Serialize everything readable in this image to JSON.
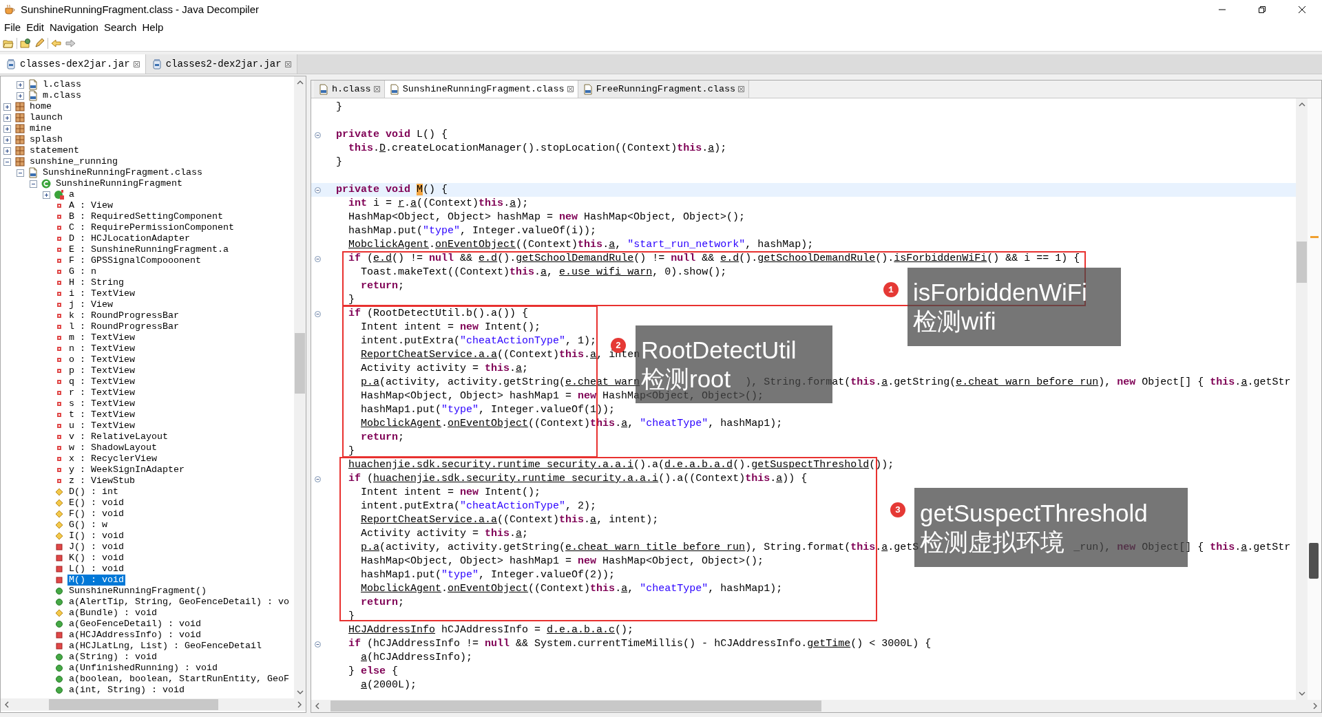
{
  "window": {
    "title": "SunshineRunningFragment.class - Java Decompiler"
  },
  "menu": [
    "File",
    "Edit",
    "Navigation",
    "Search",
    "Help"
  ],
  "jar_tabs": [
    {
      "label": "classes-dex2jar.jar",
      "selected": true
    },
    {
      "label": "classes2-dex2jar.jar",
      "selected": false
    }
  ],
  "tree": {
    "partial_branch": [
      {
        "label": "l.class",
        "kind": "class-file",
        "expanded": false,
        "selected": false
      },
      {
        "label": "m.class",
        "kind": "class-file",
        "expanded": false,
        "selected": false
      }
    ],
    "items": [
      {
        "label": "home",
        "kind": "package",
        "expanded": false,
        "selected": false
      },
      {
        "label": "launch",
        "kind": "package",
        "expanded": false,
        "selected": false
      },
      {
        "label": "mine",
        "kind": "package",
        "expanded": false,
        "selected": false
      },
      {
        "label": "splash",
        "kind": "package",
        "expanded": false,
        "selected": false
      },
      {
        "label": "statement",
        "kind": "package",
        "expanded": false,
        "selected": false
      },
      {
        "label": "sunshine_running",
        "kind": "package",
        "expanded": true,
        "selected": false,
        "children": [
          {
            "label": "SunshineRunningFragment.class",
            "kind": "class-file",
            "expanded": true,
            "selected": false,
            "children": [
              {
                "label": "SunshineRunningFragment",
                "kind": "class",
                "expanded": true,
                "selected": false,
                "children": [
                  {
                    "label": "a",
                    "kind": "inner-class",
                    "expanded": false,
                    "selected": false
                  },
                  {
                    "label": "A : View",
                    "kind": "field",
                    "selected": false
                  },
                  {
                    "label": "B : RequiredSettingComponent",
                    "kind": "field",
                    "selected": false
                  },
                  {
                    "label": "C : RequirePermissionComponent",
                    "kind": "field",
                    "selected": false
                  },
                  {
                    "label": "D : HCJLocationAdapter",
                    "kind": "field",
                    "selected": false
                  },
                  {
                    "label": "E : SunshineRunningFragment.a",
                    "kind": "field",
                    "selected": false
                  },
                  {
                    "label": "F : GPSSignalCompooonent",
                    "kind": "field",
                    "selected": false
                  },
                  {
                    "label": "G : n",
                    "kind": "field",
                    "selected": false
                  },
                  {
                    "label": "H : String",
                    "kind": "field",
                    "selected": false
                  },
                  {
                    "label": "i : TextView",
                    "kind": "field",
                    "selected": false
                  },
                  {
                    "label": "j : View",
                    "kind": "field",
                    "selected": false
                  },
                  {
                    "label": "k : RoundProgressBar",
                    "kind": "field",
                    "selected": false
                  },
                  {
                    "label": "l : RoundProgressBar",
                    "kind": "field",
                    "selected": false
                  },
                  {
                    "label": "m : TextView",
                    "kind": "field",
                    "selected": false
                  },
                  {
                    "label": "n : TextView",
                    "kind": "field",
                    "selected": false
                  },
                  {
                    "label": "o : TextView",
                    "kind": "field",
                    "selected": false
                  },
                  {
                    "label": "p : TextView",
                    "kind": "field",
                    "selected": false
                  },
                  {
                    "label": "q : TextView",
                    "kind": "field",
                    "selected": false
                  },
                  {
                    "label": "r : TextView",
                    "kind": "field",
                    "selected": false
                  },
                  {
                    "label": "s : TextView",
                    "kind": "field",
                    "selected": false
                  },
                  {
                    "label": "t : TextView",
                    "kind": "field",
                    "selected": false
                  },
                  {
                    "label": "u : TextView",
                    "kind": "field",
                    "selected": false
                  },
                  {
                    "label": "v : RelativeLayout",
                    "kind": "field",
                    "selected": false
                  },
                  {
                    "label": "w : ShadowLayout",
                    "kind": "field",
                    "selected": false
                  },
                  {
                    "label": "x : RecyclerView",
                    "kind": "field",
                    "selected": false
                  },
                  {
                    "label": "y : WeekSignInAdapter",
                    "kind": "field",
                    "selected": false
                  },
                  {
                    "label": "z : ViewStub",
                    "kind": "field",
                    "selected": false
                  },
                  {
                    "label": "D() : int",
                    "kind": "default-method",
                    "selected": false
                  },
                  {
                    "label": "E() : void",
                    "kind": "default-method",
                    "selected": false
                  },
                  {
                    "label": "F() : void",
                    "kind": "default-method",
                    "selected": false
                  },
                  {
                    "label": "G() : w",
                    "kind": "default-method",
                    "selected": false
                  },
                  {
                    "label": "I() : void",
                    "kind": "default-method",
                    "selected": false
                  },
                  {
                    "label": "J() : void",
                    "kind": "private-method",
                    "selected": false
                  },
                  {
                    "label": "K() : void",
                    "kind": "private-method",
                    "selected": false
                  },
                  {
                    "label": "L() : void",
                    "kind": "private-method",
                    "selected": false
                  },
                  {
                    "label": "M() : void",
                    "kind": "private-method",
                    "selected": true
                  },
                  {
                    "label": "SunshineRunningFragment()",
                    "kind": "public-method",
                    "selected": false
                  },
                  {
                    "label": "a(AlertTip, String, GeoFenceDetail) : vo",
                    "kind": "public-method",
                    "selected": false
                  },
                  {
                    "label": "a(Bundle) : void",
                    "kind": "default-method",
                    "selected": false
                  },
                  {
                    "label": "a(GeoFenceDetail) : void",
                    "kind": "public-method",
                    "selected": false
                  },
                  {
                    "label": "a(HCJAddressInfo) : void",
                    "kind": "private-method",
                    "selected": false
                  },
                  {
                    "label": "a(HCJLatLng, List) : GeoFenceDetail",
                    "kind": "private-method",
                    "selected": false
                  },
                  {
                    "label": "a(String) : void",
                    "kind": "public-method",
                    "selected": false
                  },
                  {
                    "label": "a(UnfinishedRunning) : void",
                    "kind": "public-method",
                    "selected": false
                  },
                  {
                    "label": "a(boolean, boolean, StartRunEntity, GeoF",
                    "kind": "public-method",
                    "selected": false
                  },
                  {
                    "label": "a(int, String) : void",
                    "kind": "public-method",
                    "selected": false
                  }
                ]
              }
            ]
          }
        ]
      }
    ]
  },
  "editor_tabs": [
    {
      "label": "h.class",
      "selected": false
    },
    {
      "label": "SunshineRunningFragment.class",
      "selected": true
    },
    {
      "label": "FreeRunningFragment.class",
      "selected": false
    }
  ],
  "editor": {
    "lines": [
      {
        "fold": false,
        "selected": false,
        "tokens": [
          "  }"
        ]
      },
      {
        "fold": false,
        "selected": false
      },
      {
        "fold": true,
        "selected": false,
        "tokens": [
          {
            "kind": "keyword",
            "text": "  private "
          },
          {
            "kind": "keyword",
            "text": "void"
          },
          " L() {"
        ]
      },
      {
        "fold": false,
        "selected": false,
        "tokens": [
          {
            "kind": "keyword",
            "text": "    this"
          },
          ".",
          {
            "kind": "link",
            "text": "D"
          },
          ".createLocationManager().stopLocation((Context)",
          {
            "kind": "keyword",
            "text": "this"
          },
          ".",
          {
            "kind": "link",
            "text": "a"
          },
          ");"
        ]
      },
      {
        "fold": false,
        "selected": false,
        "tokens": [
          "  }"
        ]
      },
      {
        "fold": false,
        "selected": false
      },
      {
        "fold": true,
        "selected": true,
        "tokens": [
          {
            "kind": "keyword",
            "text": "  private "
          },
          {
            "kind": "keyword",
            "text": "void "
          },
          {
            "kind": "match",
            "text": "M"
          },
          "() {"
        ]
      },
      {
        "fold": false,
        "selected": false,
        "tokens": [
          {
            "kind": "keyword",
            "text": "    int"
          },
          " i = ",
          {
            "kind": "link",
            "text": "r"
          },
          ".",
          {
            "kind": "link",
            "text": "a"
          },
          "((Context)",
          {
            "kind": "keyword",
            "text": "this"
          },
          ".",
          {
            "kind": "link",
            "text": "a"
          },
          ");"
        ]
      },
      {
        "fold": false,
        "selected": false,
        "tokens": [
          "    HashMap<Object, Object> hashMap = ",
          {
            "kind": "keyword",
            "text": "new"
          },
          " HashMap<Object, Object>();"
        ]
      },
      {
        "fold": false,
        "selected": false,
        "tokens": [
          "    hashMap.put(",
          {
            "kind": "string",
            "text": "\"type\""
          },
          ", Integer.valueOf(i));"
        ]
      },
      {
        "fold": false,
        "selected": false,
        "tokens": [
          {
            "kind": "link",
            "text": "    MobclickAgent"
          },
          ".",
          {
            "kind": "link",
            "text": "onEventObject"
          },
          "((Context)",
          {
            "kind": "keyword",
            "text": "this"
          },
          ".",
          {
            "kind": "link",
            "text": "a"
          },
          ", ",
          {
            "kind": "string",
            "text": "\"start_run_network\""
          },
          ", hashMap);"
        ]
      },
      {
        "fold": true,
        "selected": false,
        "tokens": [
          {
            "kind": "keyword",
            "text": "    if"
          },
          " (",
          {
            "kind": "link",
            "text": "e.d"
          },
          "() != ",
          {
            "kind": "keyword",
            "text": "null"
          },
          " && ",
          {
            "kind": "link",
            "text": "e.d"
          },
          "().",
          {
            "kind": "link",
            "text": "getSchoolDemandRule"
          },
          "() != ",
          {
            "kind": "keyword",
            "text": "null"
          },
          " && ",
          {
            "kind": "link",
            "text": "e.d"
          },
          "().",
          {
            "kind": "link",
            "text": "getSchoolDemandRule"
          },
          "().",
          {
            "kind": "link",
            "text": "isForbiddenWiFi"
          },
          "() && i == 1) {"
        ]
      },
      {
        "fold": false,
        "selected": false,
        "tokens": [
          "      Toast.makeText((Context)",
          {
            "kind": "keyword",
            "text": "this"
          },
          ".",
          {
            "kind": "link",
            "text": "a"
          },
          ", ",
          {
            "kind": "link",
            "text": "e.use_wifi_warn"
          },
          ", 0).show();"
        ]
      },
      {
        "fold": false,
        "selected": false,
        "tokens": [
          {
            "kind": "keyword",
            "text": "      return"
          },
          ";"
        ]
      },
      {
        "fold": false,
        "selected": false,
        "tokens": [
          "    }"
        ]
      },
      {
        "fold": true,
        "selected": false,
        "tokens": [
          {
            "kind": "keyword",
            "text": "    if"
          },
          " (RootDetectUtil.b().a()) {"
        ]
      },
      {
        "fold": false,
        "selected": false,
        "tokens": [
          "      Intent intent = ",
          {
            "kind": "keyword",
            "text": "new"
          },
          " Intent();"
        ]
      },
      {
        "fold": false,
        "selected": false,
        "tokens": [
          "      intent.putExtra(",
          {
            "kind": "string",
            "text": "\"cheatActionType\""
          },
          ", 1);"
        ]
      },
      {
        "fold": false,
        "selected": false,
        "tokens": [
          {
            "kind": "link",
            "text": "      ReportCheatService.a.a"
          },
          "((Context)",
          {
            "kind": "keyword",
            "text": "this"
          },
          ".",
          {
            "kind": "link",
            "text": "a"
          },
          ", inten"
        ]
      },
      {
        "fold": false,
        "selected": false,
        "tokens": [
          "      Activity activity = ",
          {
            "kind": "keyword",
            "text": "this"
          },
          ".",
          {
            "kind": "link",
            "text": "a"
          },
          ";"
        ]
      },
      {
        "fold": false,
        "selected": false,
        "tokens": [
          {
            "kind": "link",
            "text": "      p.a"
          },
          "(activity, activity.getString(",
          {
            "kind": "link",
            "text": "e.cheat_warn"
          }
        ],
        "resume": [
          "), String.format(",
          {
            "kind": "keyword",
            "text": "this"
          },
          ".",
          {
            "kind": "link",
            "text": "a"
          },
          ".getString(",
          {
            "kind": "link",
            "text": "e.cheat_warn_before_run"
          },
          "), ",
          {
            "kind": "keyword",
            "text": "new"
          },
          " Object[] { ",
          {
            "kind": "keyword",
            "text": "this"
          },
          ".",
          {
            "kind": "link",
            "text": "a"
          },
          ".getStr"
        ]
      },
      {
        "fold": false,
        "selected": false,
        "tokens": [
          "      HashMap<Object, Object> hashMap1 = ",
          {
            "kind": "keyword",
            "text": "new"
          },
          " HashMap<Object, Object>();"
        ]
      },
      {
        "fold": false,
        "selected": false,
        "tokens": [
          "      hashMap1.put(",
          {
            "kind": "string",
            "text": "\"type\""
          },
          ", Integer.valueOf(1));"
        ]
      },
      {
        "fold": false,
        "selected": false,
        "tokens": [
          {
            "kind": "link",
            "text": "      MobclickAgent"
          },
          ".",
          {
            "kind": "link",
            "text": "onEventObject"
          },
          "((Context)",
          {
            "kind": "keyword",
            "text": "this"
          },
          ".",
          {
            "kind": "link",
            "text": "a"
          },
          ", ",
          {
            "kind": "string",
            "text": "\"cheatType\""
          },
          ", hashMap1);"
        ]
      },
      {
        "fold": false,
        "selected": false,
        "tokens": [
          {
            "kind": "keyword",
            "text": "      return"
          },
          ";"
        ]
      },
      {
        "fold": false,
        "selected": false,
        "tokens": [
          "    }"
        ]
      },
      {
        "fold": false,
        "selected": false,
        "tokens": [
          {
            "kind": "link",
            "text": "    huachenjie.sdk.security.runtime_security.a.a.i"
          },
          "().a(",
          {
            "kind": "link",
            "text": "d.e.a.b.a.d"
          },
          "().",
          {
            "kind": "link",
            "text": "getSuspectThreshold"
          },
          "());"
        ]
      },
      {
        "fold": true,
        "selected": false,
        "tokens": [
          {
            "kind": "keyword",
            "text": "    if"
          },
          " (",
          {
            "kind": "link",
            "text": "huachenjie.sdk.security.runtime_security.a.a.i"
          },
          "().a((Context)",
          {
            "kind": "keyword",
            "text": "this"
          },
          ".",
          {
            "kind": "link",
            "text": "a"
          },
          ")) {"
        ]
      },
      {
        "fold": false,
        "selected": false,
        "tokens": [
          "      Intent intent = ",
          {
            "kind": "keyword",
            "text": "new"
          },
          " Intent();"
        ]
      },
      {
        "fold": false,
        "selected": false,
        "tokens": [
          "      intent.putExtra(",
          {
            "kind": "string",
            "text": "\"cheatActionType\""
          },
          ", 2);"
        ]
      },
      {
        "fold": false,
        "selected": false,
        "tokens": [
          {
            "kind": "link",
            "text": "      ReportCheatService.a.a"
          },
          "((Context)",
          {
            "kind": "keyword",
            "text": "this"
          },
          ".",
          {
            "kind": "link",
            "text": "a"
          },
          ", intent);"
        ]
      },
      {
        "fold": false,
        "selected": false,
        "tokens": [
          "      Activity activity = ",
          {
            "kind": "keyword",
            "text": "this"
          },
          ".",
          {
            "kind": "link",
            "text": "a"
          },
          ";"
        ]
      },
      {
        "fold": false,
        "selected": false,
        "tokens": [
          {
            "kind": "link",
            "text": "      p.a"
          },
          "(activity, activity.getString(",
          {
            "kind": "link",
            "text": "e.cheat_warn_title_before_run"
          },
          "), String.format(",
          {
            "kind": "keyword",
            "text": "this"
          },
          ".",
          {
            "kind": "link",
            "text": "a"
          },
          ".getS"
        ],
        "resume": [
          "_run), ",
          {
            "kind": "keyword",
            "text": "new"
          },
          " Object[] { ",
          {
            "kind": "keyword",
            "text": "this"
          },
          ".",
          {
            "kind": "link",
            "text": "a"
          },
          ".getStr"
        ]
      },
      {
        "fold": false,
        "selected": false,
        "tokens": [
          "      HashMap<Object, Object> hashMap1 = ",
          {
            "kind": "keyword",
            "text": "new"
          },
          " HashMap<Object, Object>();"
        ]
      },
      {
        "fold": false,
        "selected": false,
        "tokens": [
          "      hashMap1.put(",
          {
            "kind": "string",
            "text": "\"type\""
          },
          ", Integer.valueOf(2));"
        ]
      },
      {
        "fold": false,
        "selected": false,
        "tokens": [
          {
            "kind": "link",
            "text": "      MobclickAgent"
          },
          ".",
          {
            "kind": "link",
            "text": "onEventObject"
          },
          "((Context)",
          {
            "kind": "keyword",
            "text": "this"
          },
          ".",
          {
            "kind": "link",
            "text": "a"
          },
          ", ",
          {
            "kind": "string",
            "text": "\"cheatType\""
          },
          ", hashMap1);"
        ]
      },
      {
        "fold": false,
        "selected": false,
        "tokens": [
          {
            "kind": "keyword",
            "text": "      return"
          },
          ";"
        ]
      },
      {
        "fold": false,
        "selected": false,
        "tokens": [
          "    }"
        ]
      },
      {
        "fold": false,
        "selected": false,
        "tokens": [
          {
            "kind": "link",
            "text": "    HCJAddressInfo"
          },
          " hCJAddressInfo = ",
          {
            "kind": "link",
            "text": "d.e.a.b.a.c"
          },
          "();"
        ]
      },
      {
        "fold": true,
        "selected": false,
        "tokens": [
          {
            "kind": "keyword",
            "text": "    if"
          },
          " (hCJAddressInfo != ",
          {
            "kind": "keyword",
            "text": "null"
          },
          " && System.currentTimeMillis() - hCJAddressInfo.",
          {
            "kind": "link",
            "text": "getTime"
          },
          "() < 3000L) {"
        ]
      },
      {
        "fold": false,
        "selected": false,
        "tokens": [
          {
            "kind": "link",
            "text": "      a"
          },
          "(hCJAddressInfo);"
        ]
      },
      {
        "fold": false,
        "selected": false,
        "tokens": [
          "    } ",
          {
            "kind": "keyword",
            "text": "else"
          },
          " {"
        ]
      },
      {
        "fold": false,
        "selected": false,
        "tokens": [
          {
            "kind": "link",
            "text": "      a"
          },
          "(2000L);"
        ]
      }
    ]
  },
  "callouts": [
    {
      "number": "1",
      "lines": [
        "isForbiddenWiFi",
        "检测wifi"
      ]
    },
    {
      "number": "2",
      "lines": [
        "RootDetectUtil",
        "检测root"
      ]
    },
    {
      "number": "3",
      "lines": [
        "getSuspectThreshold",
        "检测虚拟环境"
      ]
    }
  ]
}
